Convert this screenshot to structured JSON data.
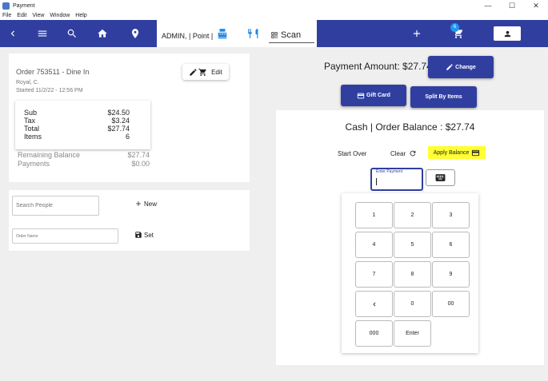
{
  "window": {
    "title": "Payment",
    "controls": {
      "minimize": "—",
      "maximize": "☐",
      "close": "✕"
    }
  },
  "menu": [
    "File",
    "Edit",
    "View",
    "Window",
    "Help"
  ],
  "navbar": {
    "user_context": "ADMIN, | Point |",
    "scan_label": "Scan",
    "cart_count": "6",
    "colors": {
      "primary": "#303f9f",
      "accent": "#1e88e5"
    },
    "icons": [
      "back-icon",
      "menu-icon",
      "search-icon",
      "home-icon",
      "location-icon",
      "register-icon",
      "utensils-icon",
      "qr-code-icon",
      "plus-icon",
      "cart-icon",
      "person-icon"
    ]
  },
  "order": {
    "title": "Order 753511 - Dine In",
    "customer": "Royal, C.",
    "started": "Started 11/2/22 - 12:56 PM",
    "edit_label": "Edit",
    "totals": [
      {
        "label": "Sub",
        "value": "$24.50"
      },
      {
        "label": "Tax",
        "value": "$3.24"
      },
      {
        "label": "Total",
        "value": "$27.74"
      },
      {
        "label": "Items",
        "value": "6"
      }
    ],
    "remaining": {
      "label": "Remaining Balance",
      "value": "$27.74"
    },
    "payments": {
      "label": "Payments",
      "value": "$0.00"
    }
  },
  "people": {
    "search_placeholder": "Search People",
    "new_label": "New",
    "order_name_placeholder": "Order Name",
    "set_label": "Set"
  },
  "payment": {
    "amount": "Payment Amount: $27.74",
    "change_label": "Change",
    "gift_card_label": "Gift Card",
    "split_label": "Split By Items",
    "balance_title": "Cash | Order Balance : $27.74",
    "start_over": "Start Over",
    "clear": "Clear",
    "apply_balance": "Apply Balance",
    "enter_payment_label": "Enter Payment",
    "highlight_color": "#ffff33"
  },
  "keypad": {
    "keys": [
      "1",
      "2",
      "3",
      "4",
      "5",
      "6",
      "7",
      "8",
      "9",
      "",
      "0",
      "00",
      "000",
      "Enter"
    ]
  }
}
